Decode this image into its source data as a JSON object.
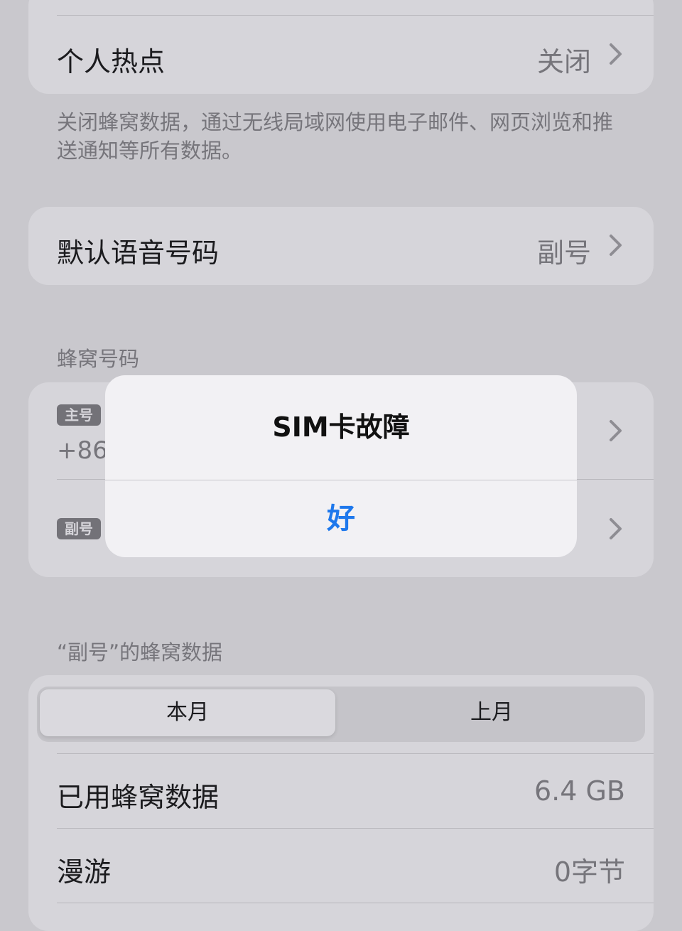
{
  "hotspot": {
    "label": "个人热点",
    "value": "关闭"
  },
  "cellular_off_footer": "关闭蜂窝数据，通过无线局域网使用电子邮件、网页浏览和推送通知等所有数据。",
  "default_voice": {
    "label": "默认语音号码",
    "value": "副号"
  },
  "cellular_numbers": {
    "header": "蜂窝号码",
    "primary_badge": "主号",
    "primary_number_partial": "+86",
    "secondary_badge": "副号"
  },
  "secondary_data": {
    "header": "“副号”的蜂窝数据",
    "segments": [
      "本月",
      "上月"
    ],
    "selected_segment": "本月",
    "rows": [
      {
        "label": "已用蜂窝数据",
        "value": "6.4 GB"
      },
      {
        "label": "漫游",
        "value": "0字节"
      }
    ]
  },
  "alert": {
    "title": "SIM卡故障",
    "button": "好"
  },
  "colors": {
    "accent": "#1e78ec",
    "background": "#c9c8cd",
    "group": "#d6d5da"
  },
  "icons": {
    "chevron": "chevron-right-icon"
  }
}
